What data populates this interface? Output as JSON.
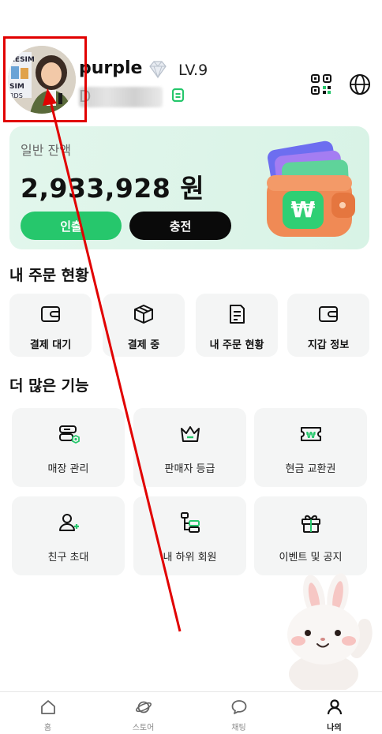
{
  "header": {
    "username": "purple",
    "level": "LV.9",
    "uid_prefix": "D",
    "avatar_sign_text": [
      "RESIM",
      "SIM",
      "RDS"
    ]
  },
  "balance": {
    "label": "일반 잔액",
    "amount": "2,933,928 원",
    "withdraw_label": "인출",
    "charge_label": "충전",
    "wallet_badge": "₩"
  },
  "orders": {
    "title": "내 주문 현황",
    "items": [
      {
        "label": "결제 대기",
        "icon": "wallet-icon"
      },
      {
        "label": "결제 중",
        "icon": "box-icon"
      },
      {
        "label": "내 주문 현황",
        "icon": "document-icon"
      },
      {
        "label": "지갑 정보",
        "icon": "wallet-icon"
      }
    ]
  },
  "features": {
    "title": "더 많은 기능",
    "items": [
      {
        "label": "매장 관리",
        "icon": "store-settings-icon"
      },
      {
        "label": "판매자 등급",
        "icon": "crown-icon"
      },
      {
        "label": "현금 교환권",
        "icon": "won-ticket-icon"
      },
      {
        "label": "친구 초대",
        "icon": "add-user-icon"
      },
      {
        "label": "내 하위 회원",
        "icon": "hierarchy-icon"
      },
      {
        "label": "이벤트 및 공지",
        "icon": "gift-icon"
      }
    ]
  },
  "nav": {
    "items": [
      {
        "label": "홈",
        "icon": "home-icon",
        "active": false
      },
      {
        "label": "스토어",
        "icon": "planet-icon",
        "active": false
      },
      {
        "label": "채팅",
        "icon": "chat-icon",
        "active": false
      },
      {
        "label": "나의",
        "icon": "user-icon",
        "active": true
      }
    ]
  },
  "colors": {
    "accent_green": "#26c76c",
    "card_bg": "#d8f3e6",
    "annotation_red": "#e10000"
  }
}
